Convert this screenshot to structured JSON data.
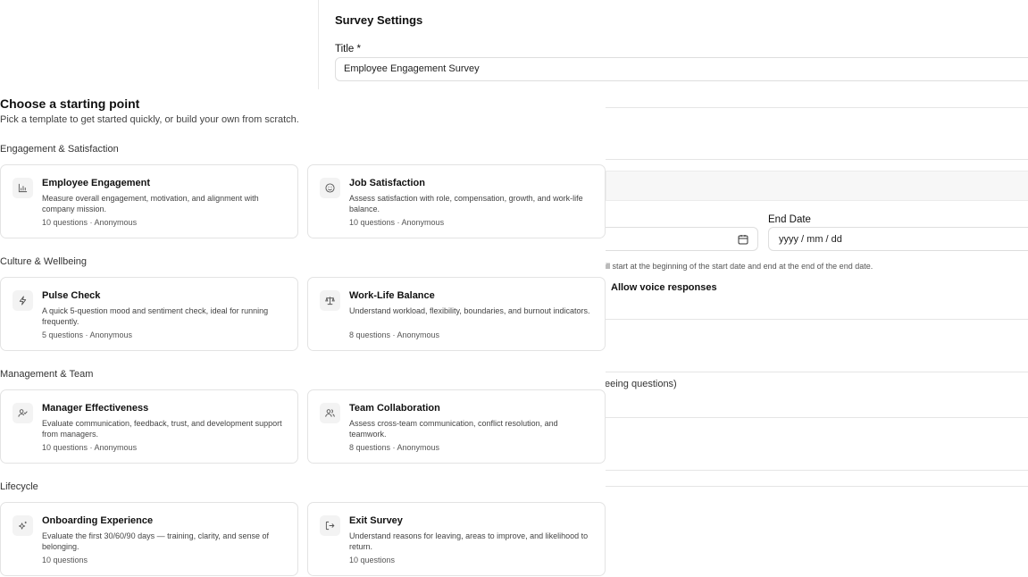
{
  "settings": {
    "heading": "Survey Settings",
    "title_label": "Title *",
    "title_value": "Employee Engagement Survey",
    "end_date_label": "End Date",
    "end_date_placeholder": "yyyy / mm / dd",
    "date_helper": "ill start at the beginning of the start date and end at the end of the end date.",
    "voice_label": "Allow voice responses",
    "wellbeing_partial": "eeing questions)"
  },
  "chooser": {
    "title": "Choose a starting point",
    "subtitle": "Pick a template to get started quickly, or build your own from scratch.",
    "sections": [
      {
        "title": "Engagement & Satisfaction",
        "cards": [
          {
            "icon": "bar-chart-icon",
            "title": "Employee Engagement",
            "desc": "Measure overall engagement, motivation, and alignment with company mission.",
            "meta": "10 questions · Anonymous"
          },
          {
            "icon": "smile-icon",
            "title": "Job Satisfaction",
            "desc": "Assess satisfaction with role, compensation, growth, and work-life balance.",
            "meta": "10 questions · Anonymous"
          }
        ]
      },
      {
        "title": "Culture & Wellbeing",
        "cards": [
          {
            "icon": "lightning-icon",
            "title": "Pulse Check",
            "desc": "A quick 5-question mood and sentiment check, ideal for running frequently.",
            "meta": "5 questions · Anonymous"
          },
          {
            "icon": "scale-icon",
            "title": "Work-Life Balance",
            "desc": "Understand workload, flexibility, boundaries, and burnout indicators.",
            "meta": "8 questions · Anonymous"
          }
        ]
      },
      {
        "title": "Management & Team",
        "cards": [
          {
            "icon": "user-check-icon",
            "title": "Manager Effectiveness",
            "desc": "Evaluate communication, feedback, trust, and development support from managers.",
            "meta": "10 questions · Anonymous"
          },
          {
            "icon": "users-icon",
            "title": "Team Collaboration",
            "desc": "Assess cross-team communication, conflict resolution, and teamwork.",
            "meta": "8 questions · Anonymous"
          }
        ]
      },
      {
        "title": "Lifecycle",
        "cards": [
          {
            "icon": "sparkles-icon",
            "title": "Onboarding Experience",
            "desc": "Evaluate the first 30/60/90 days — training, clarity, and sense of belonging.",
            "meta": "10 questions"
          },
          {
            "icon": "log-out-icon",
            "title": "Exit Survey",
            "desc": "Understand reasons for leaving, areas to improve, and likelihood to return.",
            "meta": "10 questions"
          }
        ]
      }
    ]
  }
}
